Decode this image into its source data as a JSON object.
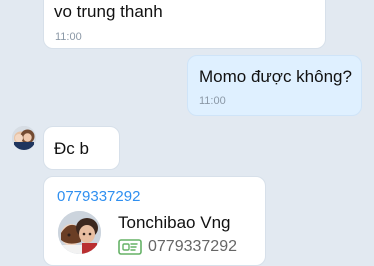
{
  "messages": [
    {
      "text": "vo trung thanh",
      "time": "11:00"
    },
    {
      "text": "Momo được không?",
      "time": "11:00"
    },
    {
      "text": "Đc b"
    }
  ],
  "contact_card": {
    "phone_link": "0779337292",
    "name": "Tonchibao Vng",
    "number": "0779337292"
  },
  "colors": {
    "background": "#e2e9f1",
    "incoming_bubble": "#ffffff",
    "outgoing_bubble": "#dff0ff",
    "link": "#2f8ff0",
    "timestamp": "#8b98a6"
  },
  "icons": [
    "avatar-icon",
    "contact-card-icon"
  ]
}
